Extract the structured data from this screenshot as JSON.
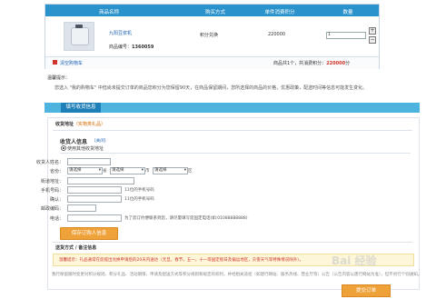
{
  "cart": {
    "headers": [
      "商品名称",
      "购买方式",
      "单件消费积分",
      "数量"
    ],
    "item": {
      "name": "九阳豆浆机",
      "no_label": "商品编号：",
      "no_value": "1360059",
      "method": "积分兑换",
      "points": "220000",
      "qty": "1"
    },
    "clear_link": "清空购物车",
    "total": "商品共1个，共消费积分：",
    "total_points": "220000",
    "total_unit": "分"
  },
  "tips": {
    "title": "温馨提示：",
    "text": "您选入 \"我的购物车\" 中但尚未提交订单的商品您积分为您保留90天，在商品保留期间，您所选择的商品的价格，优惠政策，配送时间等信息可能发生变化。"
  },
  "section_tab": "填写收货信息",
  "address": {
    "title": "收货地址",
    "subtitle": "（实物类礼品）",
    "panel_title": "收货人信息",
    "panel_close": "[关闭]",
    "radio_label": "使用其他收货地址",
    "name_label": "收货人姓名：",
    "province_label": "省份：",
    "sel_province": "请选择",
    "unit_province": "省",
    "sel_city": "请选择",
    "unit_city": "市",
    "sel_district": "请选择",
    "unit_district": "区",
    "street_label": "街道地址：",
    "mobile_label": "手机号码：",
    "mobile_hint": "11位的手机号码",
    "confirm_label": "确认：",
    "confirm_hint": "11位的手机号码",
    "zip_label": "邮政编码：",
    "phone_label": "电话：",
    "phone_hint": "为了您订约便联系到您，请尽量填写您固定电话(如:01088888888)",
    "save_button": "保存订购人信息"
  },
  "delivery": {
    "title": "送货方式 / 备注信息",
    "notice": "温馨提示：礼品通常在您提出兑换申请后的20天内送达（元旦，春节，五一，十一等国定假日及偏远地区，灾害天气等特殊情况除外）。"
  },
  "footnote": "我行保留随时变更对积分规则、积分礼品、活动期限、申请及配送方式等积分规则和规定的权利，并经相关途径（如建行网站、服务热线、营业厅等）公告（公告内容以建行网站为准），但不另行个别通知。",
  "submit_button": "提交订单",
  "watermark": "Bai 经验"
}
